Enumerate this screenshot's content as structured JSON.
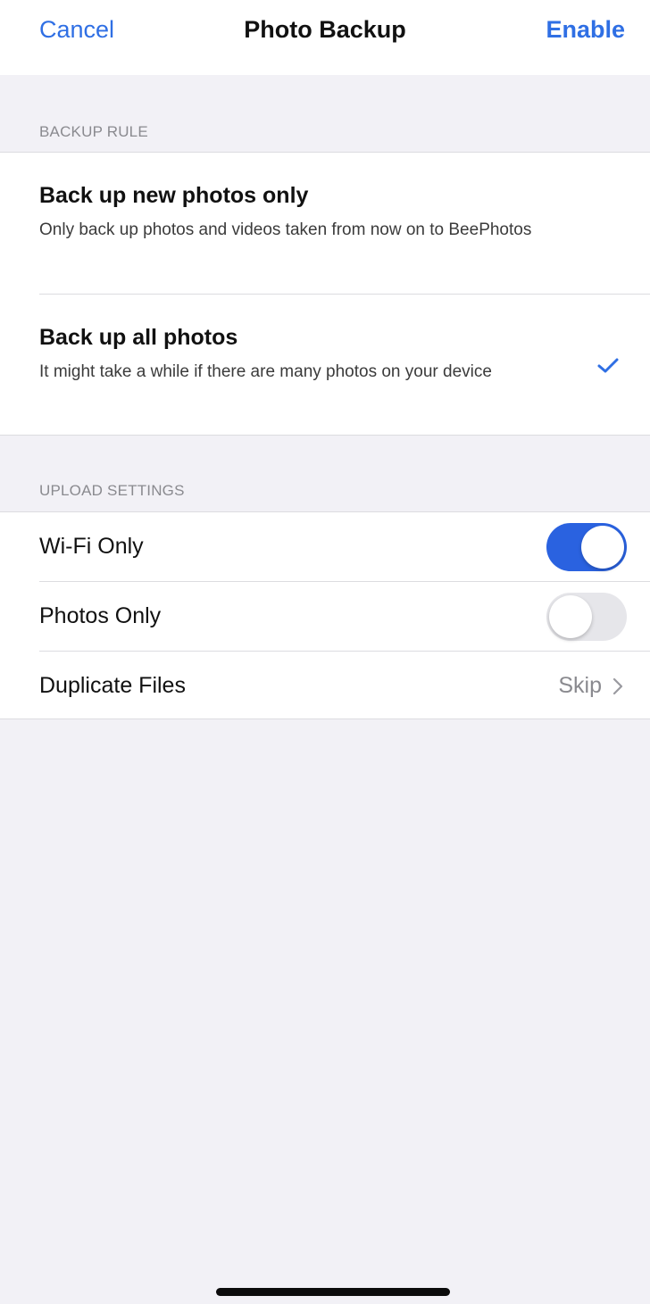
{
  "nav": {
    "cancel_label": "Cancel",
    "title": "Photo Backup",
    "enable_label": "Enable"
  },
  "backup_rule": {
    "header": "BACKUP RULE",
    "options": [
      {
        "title": "Back up new photos only",
        "description": "Only back up photos and videos taken from now on to BeePhotos",
        "selected": false
      },
      {
        "title": "Back up all photos",
        "description": "It might take a while if there are many photos on your device",
        "selected": true
      }
    ]
  },
  "upload_settings": {
    "header": "UPLOAD SETTINGS",
    "wifi_only": {
      "label": "Wi-Fi Only",
      "on": true
    },
    "photos_only": {
      "label": "Photos Only",
      "on": false
    },
    "duplicate_files": {
      "label": "Duplicate Files",
      "value": "Skip"
    }
  },
  "colors": {
    "accent": "#2f6fe4",
    "toggle_on": "#2a62e0",
    "background": "#f2f1f6"
  },
  "icons": [
    "checkmark-icon",
    "chevron-right-icon"
  ]
}
